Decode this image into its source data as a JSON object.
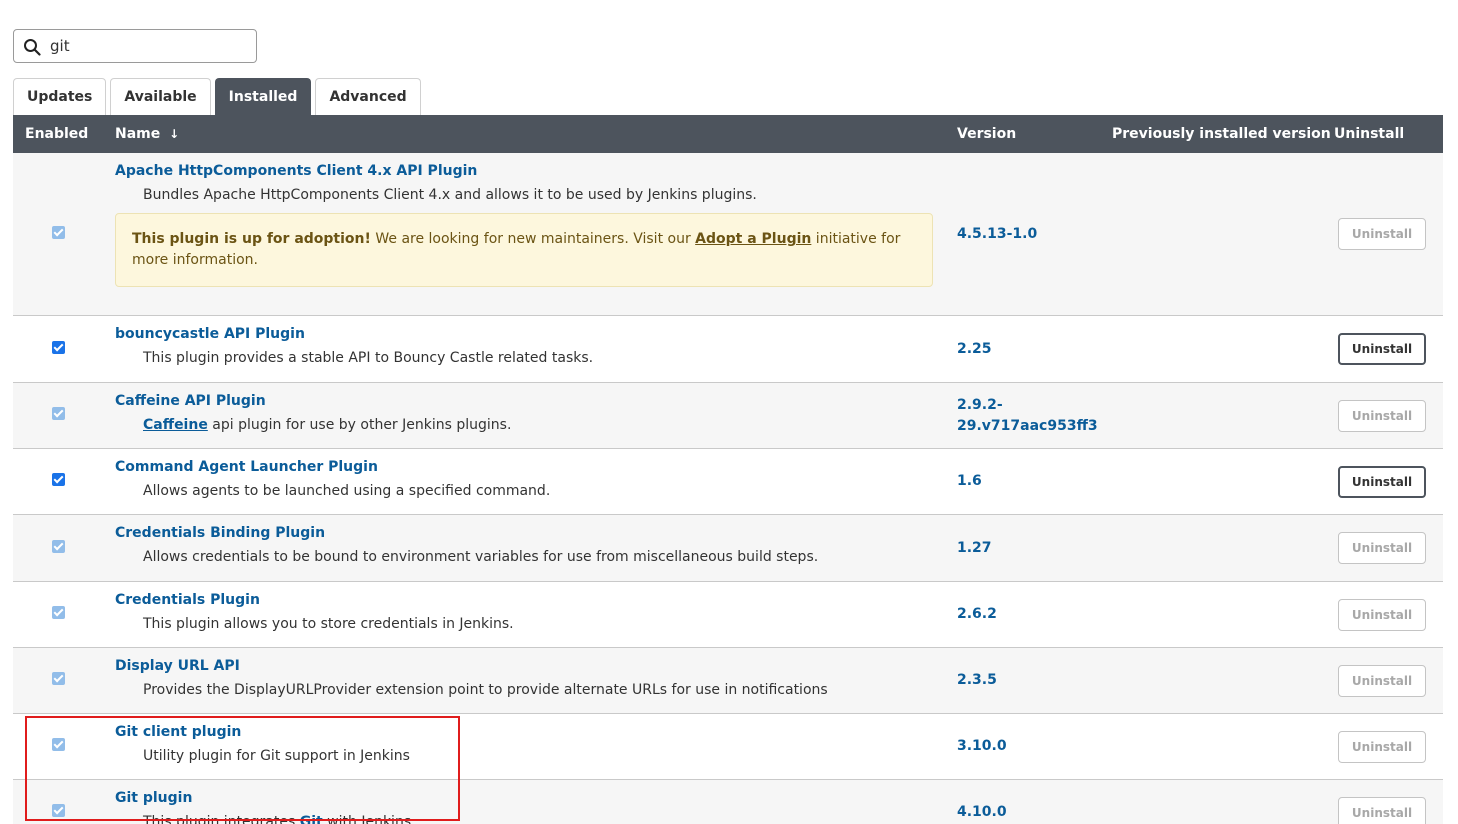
{
  "search": {
    "value": "git",
    "icon": "search-icon"
  },
  "tabs": [
    {
      "label": "Updates",
      "active": false
    },
    {
      "label": "Available",
      "active": false
    },
    {
      "label": "Installed",
      "active": true
    },
    {
      "label": "Advanced",
      "active": false
    }
  ],
  "table": {
    "headers": {
      "enabled": "Enabled",
      "name": "Name",
      "sort_indicator": "↓",
      "version": "Version",
      "previous_version": "Previously installed version",
      "uninstall": "Uninstall"
    },
    "rows": [
      {
        "name": "Apache HttpComponents Client 4.x API Plugin",
        "description": "Bundles Apache HttpComponents Client 4.x and allows it to be used by Jenkins plugins.",
        "adoption": {
          "bold": "This plugin is up for adoption!",
          "text_before_link": " We are looking for new maintainers. Visit our ",
          "link": "Adopt a Plugin",
          "text_after_link": " initiative for more information."
        },
        "version": "4.5.13-1.0",
        "enabled_checkbox_disabled": true,
        "uninstall_label": "Uninstall",
        "uninstall_enabled": false
      },
      {
        "name": "bouncycastle API Plugin",
        "description": "This plugin provides a stable API to Bouncy Castle related tasks.",
        "version": "2.25",
        "enabled_checkbox_disabled": false,
        "uninstall_label": "Uninstall",
        "uninstall_enabled": true
      },
      {
        "name": "Caffeine API Plugin",
        "description_link": "Caffeine",
        "description_rest": " api plugin for use by other Jenkins plugins.",
        "version": "2.9.2-29.v717aac953ff3",
        "version_line1": "2.9.2-",
        "version_line2": "29.v717aac953ff3",
        "enabled_checkbox_disabled": true,
        "uninstall_label": "Uninstall",
        "uninstall_enabled": false
      },
      {
        "name": "Command Agent Launcher Plugin",
        "description": "Allows agents to be launched using a specified command.",
        "version": "1.6",
        "enabled_checkbox_disabled": false,
        "uninstall_label": "Uninstall",
        "uninstall_enabled": true
      },
      {
        "name": "Credentials Binding Plugin",
        "description": "Allows credentials to be bound to environment variables for use from miscellaneous build steps.",
        "version": "1.27",
        "enabled_checkbox_disabled": true,
        "uninstall_label": "Uninstall",
        "uninstall_enabled": false
      },
      {
        "name": "Credentials Plugin",
        "description": "This plugin allows you to store credentials in Jenkins.",
        "version": "2.6.2",
        "enabled_checkbox_disabled": true,
        "uninstall_label": "Uninstall",
        "uninstall_enabled": false
      },
      {
        "name": "Display URL API",
        "description": "Provides the DisplayURLProvider extension point to provide alternate URLs for use in notifications",
        "version": "2.3.5",
        "enabled_checkbox_disabled": true,
        "uninstall_label": "Uninstall",
        "uninstall_enabled": false
      },
      {
        "name": "Git client plugin",
        "description": "Utility plugin for Git support in Jenkins",
        "version": "3.10.0",
        "enabled_checkbox_disabled": true,
        "uninstall_label": "Uninstall",
        "uninstall_enabled": false
      },
      {
        "name": "Git plugin",
        "description_before": "This plugin integrates ",
        "description_link": "Git",
        "description_after": " with Jenkins.",
        "version": "4.10.0",
        "enabled_checkbox_disabled": true,
        "uninstall_label": "Uninstall",
        "uninstall_enabled": false
      }
    ]
  },
  "colors": {
    "header_bg": "#4d545d",
    "link": "#0b5c99",
    "highlight": "#e01c1c",
    "adoption_bg": "#fdf7dd"
  }
}
